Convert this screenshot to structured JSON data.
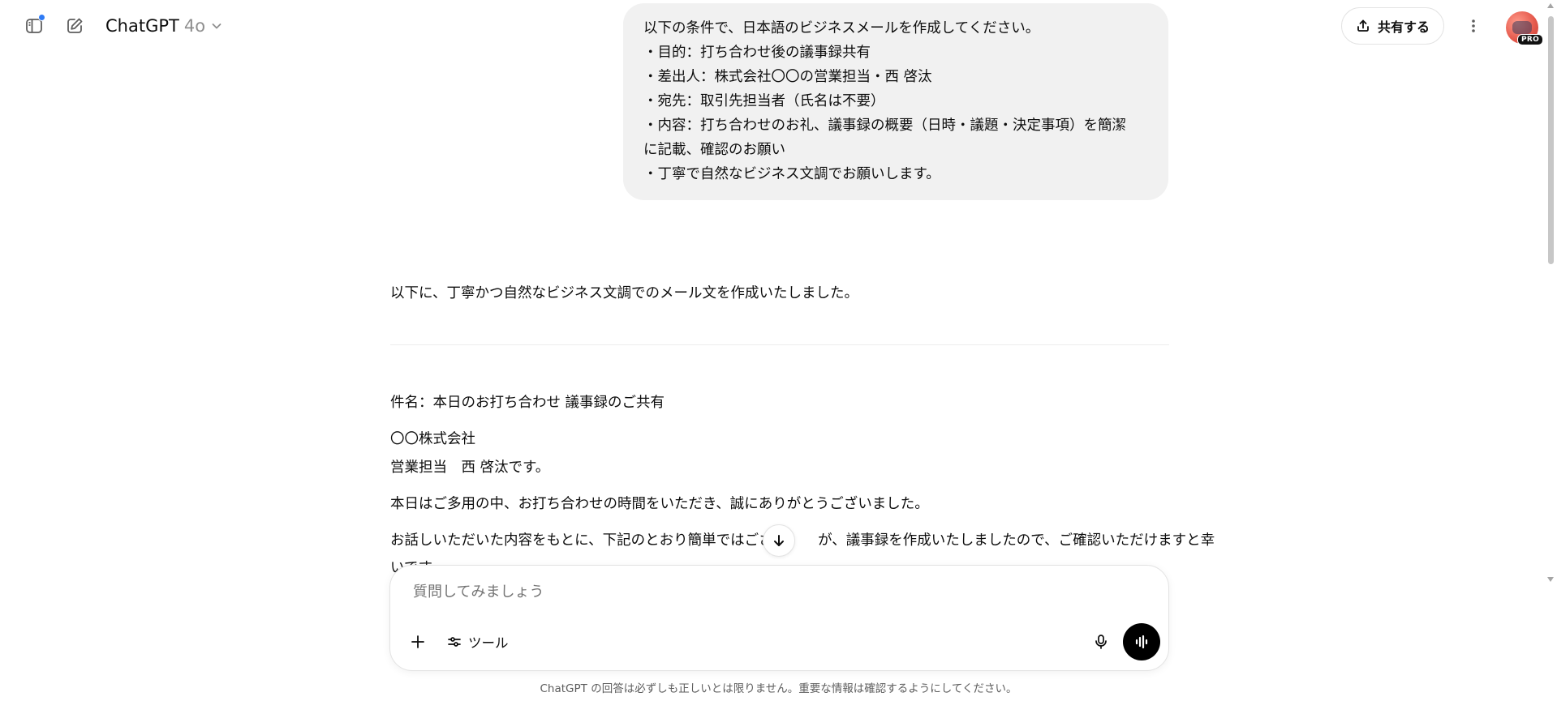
{
  "header": {
    "model_name": "ChatGPT",
    "model_version": "4o",
    "share_label": "共有する",
    "pro_badge": "PRO"
  },
  "user_message": {
    "lines": [
      "以下の条件で、日本語のビジネスメールを作成してください。",
      "・目的：打ち合わせ後の議事録共有",
      "・差出人：株式会社〇〇の営業担当・西 啓汰",
      "・宛先：取引先担当者（氏名は不要）",
      "・内容：打ち合わせのお礼、議事録の概要（日時・議題・決定事項）を簡潔",
      "に記載、確認のお願い",
      "・丁寧で自然なビジネス文調でお願いします。"
    ]
  },
  "assistant_message": {
    "intro": "以下に、丁寧かつ自然なビジネス文調でのメール文を作成いたしました。",
    "subject": "件名：本日のお打ち合わせ 議事録のご共有",
    "company": "〇〇株式会社",
    "sender": "営業担当　西 啓汰です。",
    "thanks": "本日はご多用の中、お打ち合わせの時間をいただき、誠にありがとうございました。",
    "body_line1_a": "お話しいただいた内容をもとに、下記のとおり簡単ではござい",
    "body_line1_b": "が、議事録を作成いたしましたので、ご確認いただけますと幸",
    "body_line2": "いです。"
  },
  "composer": {
    "placeholder": "質問してみましょう",
    "tools_label": "ツール"
  },
  "footer": {
    "disclaimer": "ChatGPT の回答は必ずしも正しいとは限りません。重要な情報は確認するようにしてください。"
  },
  "colors": {
    "notification_dot": "#2f7bf5",
    "bubble_bg": "#f1f1f1",
    "voice_button": "#000000"
  },
  "icons": [
    "sidebar-toggle-icon",
    "new-chat-icon",
    "chevron-down-icon",
    "share-upload-icon",
    "more-vertical-icon",
    "arrow-down-icon",
    "plus-icon",
    "tools-sliders-icon",
    "microphone-icon",
    "voice-waveform-icon"
  ]
}
